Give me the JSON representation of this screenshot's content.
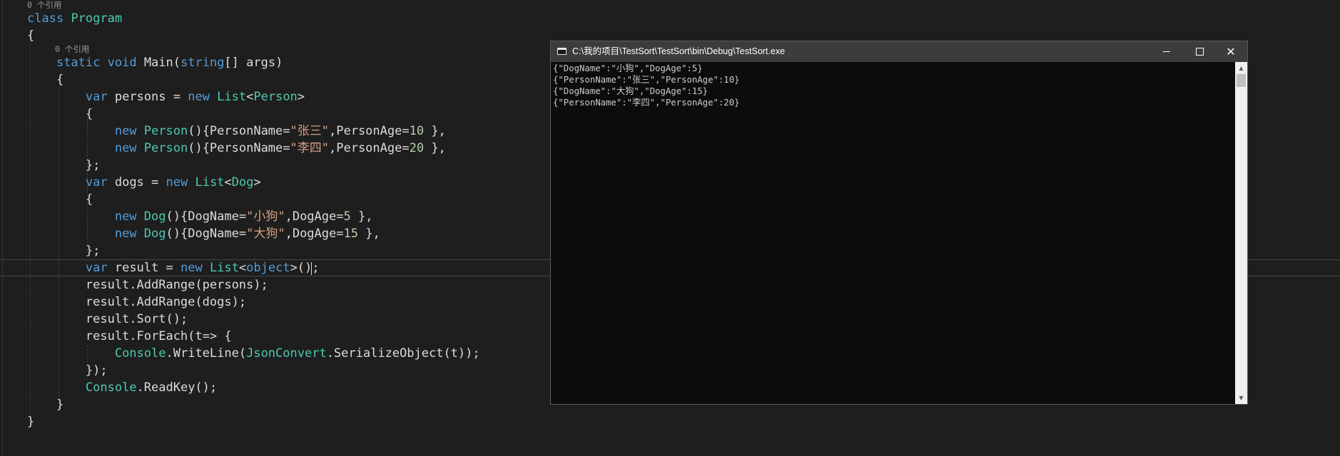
{
  "editor": {
    "codelens": [
      "0 个引用",
      "0 个引用"
    ],
    "lines": [
      [
        [
          "kw",
          "class"
        ],
        [
          "pl",
          " "
        ],
        [
          "ty",
          "Program"
        ]
      ],
      [
        [
          "pl",
          "{"
        ]
      ],
      [
        [
          "pl",
          "    "
        ],
        [
          "kw",
          "static"
        ],
        [
          "pl",
          " "
        ],
        [
          "kw",
          "void"
        ],
        [
          "pl",
          " Main("
        ],
        [
          "kw",
          "string"
        ],
        [
          "pl",
          "[] args)"
        ]
      ],
      [
        [
          "pl",
          "    {"
        ]
      ],
      [
        [
          "pl",
          "        "
        ],
        [
          "kw",
          "var"
        ],
        [
          "pl",
          " persons = "
        ],
        [
          "kw",
          "new"
        ],
        [
          "pl",
          " "
        ],
        [
          "ty",
          "List"
        ],
        [
          "pl",
          "<"
        ],
        [
          "ty",
          "Person"
        ],
        [
          "pl",
          ">"
        ]
      ],
      [
        [
          "pl",
          "        {"
        ]
      ],
      [
        [
          "pl",
          "            "
        ],
        [
          "kw",
          "new"
        ],
        [
          "pl",
          " "
        ],
        [
          "ty",
          "Person"
        ],
        [
          "pl",
          "(){PersonName="
        ],
        [
          "str",
          "\"张三\""
        ],
        [
          "pl",
          ",PersonAge="
        ],
        [
          "num",
          "10"
        ],
        [
          "pl",
          " },"
        ]
      ],
      [
        [
          "pl",
          "            "
        ],
        [
          "kw",
          "new"
        ],
        [
          "pl",
          " "
        ],
        [
          "ty",
          "Person"
        ],
        [
          "pl",
          "(){PersonName="
        ],
        [
          "str",
          "\"李四\""
        ],
        [
          "pl",
          ",PersonAge="
        ],
        [
          "num",
          "20"
        ],
        [
          "pl",
          " },"
        ]
      ],
      [
        [
          "pl",
          "        };"
        ]
      ],
      [
        [
          "pl",
          "        "
        ],
        [
          "kw",
          "var"
        ],
        [
          "pl",
          " dogs = "
        ],
        [
          "kw",
          "new"
        ],
        [
          "pl",
          " "
        ],
        [
          "ty",
          "List"
        ],
        [
          "pl",
          "<"
        ],
        [
          "ty",
          "Dog"
        ],
        [
          "pl",
          ">"
        ]
      ],
      [
        [
          "pl",
          "        {"
        ]
      ],
      [
        [
          "pl",
          "            "
        ],
        [
          "kw",
          "new"
        ],
        [
          "pl",
          " "
        ],
        [
          "ty",
          "Dog"
        ],
        [
          "pl",
          "(){DogName="
        ],
        [
          "str",
          "\"小狗\""
        ],
        [
          "pl",
          ",DogAge="
        ],
        [
          "num",
          "5"
        ],
        [
          "pl",
          " },"
        ]
      ],
      [
        [
          "pl",
          "            "
        ],
        [
          "kw",
          "new"
        ],
        [
          "pl",
          " "
        ],
        [
          "ty",
          "Dog"
        ],
        [
          "pl",
          "(){DogName="
        ],
        [
          "str",
          "\"大狗\""
        ],
        [
          "pl",
          ",DogAge="
        ],
        [
          "num",
          "15"
        ],
        [
          "pl",
          " },"
        ]
      ],
      [
        [
          "pl",
          "        };"
        ]
      ],
      [
        [
          "pl",
          "        "
        ],
        [
          "kw",
          "var"
        ],
        [
          "pl",
          " result = "
        ],
        [
          "kw",
          "new"
        ],
        [
          "pl",
          " "
        ],
        [
          "ty",
          "List"
        ],
        [
          "pl",
          "<"
        ],
        [
          "kw",
          "object"
        ],
        [
          "pl",
          ">();"
        ]
      ],
      [
        [
          "pl",
          "        result.AddRange(persons);"
        ]
      ],
      [
        [
          "pl",
          "        result.AddRange(dogs);"
        ]
      ],
      [
        [
          "pl",
          "        result.Sort();"
        ]
      ],
      [
        [
          "pl",
          "        result.ForEach(t=> {"
        ]
      ],
      [
        [
          "pl",
          "            "
        ],
        [
          "ty",
          "Console"
        ],
        [
          "pl",
          "."
        ],
        [
          "pl",
          "WriteLine("
        ],
        [
          "ty",
          "JsonConvert"
        ],
        [
          "pl",
          ".SerializeObject(t));"
        ]
      ],
      [
        [
          "pl",
          "        });"
        ]
      ],
      [
        [
          "pl",
          "        "
        ],
        [
          "ty",
          "Console"
        ],
        [
          "pl",
          ".ReadKey();"
        ]
      ],
      [
        [
          "pl",
          "    }"
        ]
      ],
      [
        [
          "pl",
          "}"
        ]
      ]
    ]
  },
  "console": {
    "title": "C:\\我的项目\\TestSort\\TestSort\\bin\\Debug\\TestSort.exe",
    "output": [
      "{\"DogName\":\"小狗\",\"DogAge\":5}",
      "{\"PersonName\":\"张三\",\"PersonAge\":10}",
      "{\"DogName\":\"大狗\",\"DogAge\":15}",
      "{\"PersonName\":\"李四\",\"PersonAge\":20}"
    ]
  },
  "colors": {
    "keyword": "#569cd6",
    "type": "#4ec9b0",
    "string": "#d69d85",
    "number": "#b5cea8",
    "editor_bg": "#1e1e1e",
    "console_bg": "#0c0c0c"
  },
  "icons": [
    "console-app-icon",
    "minimize-icon",
    "maximize-icon",
    "close-icon",
    "scroll-up-arrow-icon",
    "scroll-down-arrow-icon"
  ]
}
